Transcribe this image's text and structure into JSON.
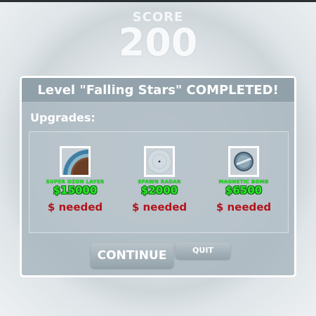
{
  "score": {
    "label": "SCORE",
    "value": "200"
  },
  "dialog": {
    "title": "Level \"Falling Stars\" COMPLETED!",
    "upgrades_label": "Upgrades:",
    "items": [
      {
        "name": "SUPER OZON LAYER",
        "price": "$15000",
        "status": "$ needed",
        "icon": "ozone-layer-icon"
      },
      {
        "name": "SPAWN RADAR",
        "price": "$2000",
        "status": "$ needed",
        "icon": "radar-icon"
      },
      {
        "name": "MAGNETIC BOMB",
        "price": "$6500",
        "status": "$ needed",
        "icon": "magnetic-bomb-icon"
      }
    ],
    "buttons": {
      "continue": "CONTINUE",
      "quit": "QUIT"
    }
  },
  "colors": {
    "price": "#2ee52e",
    "needed": "#b3141c",
    "name": "#22e022"
  }
}
